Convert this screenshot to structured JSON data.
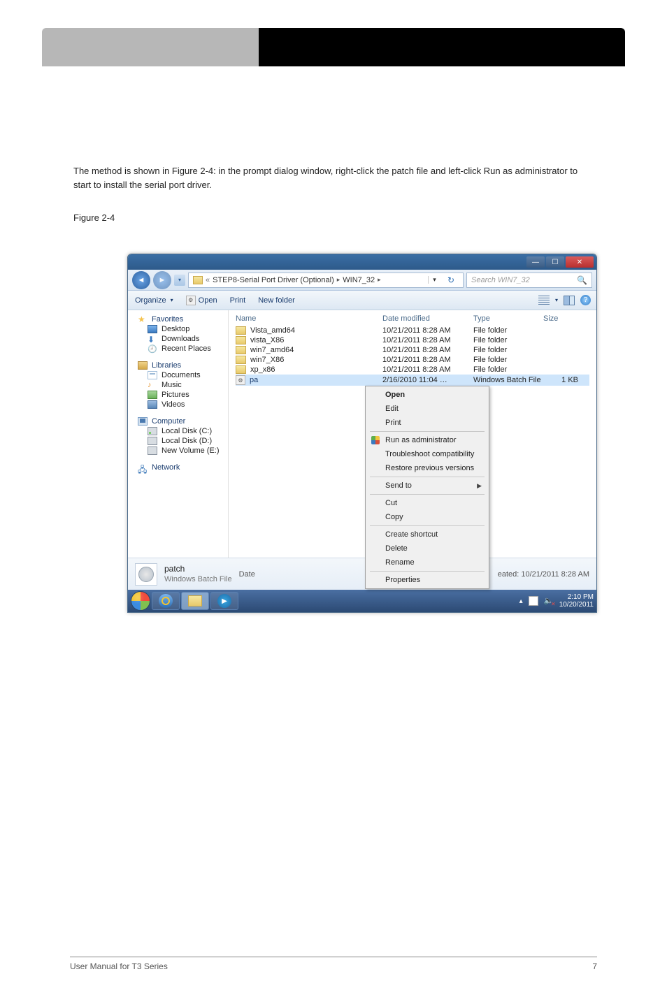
{
  "page": {
    "header_left": "",
    "header_right": "",
    "body_paragraph": "The method is shown in Figure 2-4: in the prompt dialog window, right-click the patch file and left-click Run as administrator to start to install the serial port driver.",
    "figure_label": "Figure 2-4",
    "footer_left": "User Manual for T3 Series",
    "footer_right": "7"
  },
  "explorer": {
    "breadcrumb": {
      "chevron": "«",
      "seg1": "STEP8-Serial Port Driver (Optional)",
      "seg2": "WIN7_32"
    },
    "search_placeholder": "Search WIN7_32",
    "toolbar": {
      "organize": "Organize",
      "open": "Open",
      "print": "Print",
      "newfolder": "New folder"
    },
    "columns": {
      "name": "Name",
      "date": "Date modified",
      "type": "Type",
      "size": "Size"
    },
    "nav": {
      "favorites": "Favorites",
      "desktop": "Desktop",
      "downloads": "Downloads",
      "recent": "Recent Places",
      "libraries": "Libraries",
      "documents": "Documents",
      "music": "Music",
      "pictures": "Pictures",
      "videos": "Videos",
      "computer": "Computer",
      "drive_c": "Local Disk (C:)",
      "drive_d": "Local Disk (D:)",
      "drive_e": "New Volume (E:)",
      "network": "Network"
    },
    "files": [
      {
        "name": "Vista_amd64",
        "date": "10/21/2011 8:28 AM",
        "type": "File folder",
        "size": "",
        "kind": "folder"
      },
      {
        "name": "vista_X86",
        "date": "10/21/2011 8:28 AM",
        "type": "File folder",
        "size": "",
        "kind": "folder"
      },
      {
        "name": "win7_amd64",
        "date": "10/21/2011 8:28 AM",
        "type": "File folder",
        "size": "",
        "kind": "folder"
      },
      {
        "name": "win7_X86",
        "date": "10/21/2011 8:28 AM",
        "type": "File folder",
        "size": "",
        "kind": "folder"
      },
      {
        "name": "xp_x86",
        "date": "10/21/2011 8:28 AM",
        "type": "File folder",
        "size": "",
        "kind": "folder"
      },
      {
        "name": "pa",
        "date": "2/16/2010 11:04 …",
        "type": "Windows Batch File",
        "size": "1 KB",
        "kind": "bat",
        "selected": true
      }
    ],
    "context_menu": [
      {
        "label": "Open",
        "bold": true
      },
      {
        "label": "Edit"
      },
      {
        "label": "Print"
      },
      {
        "sep": true
      },
      {
        "label": "Run as administrator",
        "shield": true
      },
      {
        "label": "Troubleshoot compatibility"
      },
      {
        "label": "Restore previous versions"
      },
      {
        "sep": true
      },
      {
        "label": "Send to",
        "submenu": true
      },
      {
        "sep": true
      },
      {
        "label": "Cut"
      },
      {
        "label": "Copy"
      },
      {
        "sep": true
      },
      {
        "label": "Create shortcut"
      },
      {
        "label": "Delete"
      },
      {
        "label": "Rename"
      },
      {
        "sep": true
      },
      {
        "label": "Properties"
      }
    ],
    "details": {
      "title": "patch",
      "subtitle": "Windows Batch File",
      "date_label": "Date",
      "created_label": "eated: 10/21/2011 8:28 AM"
    }
  },
  "taskbar": {
    "time": "2:10 PM",
    "date": "10/20/2011"
  }
}
